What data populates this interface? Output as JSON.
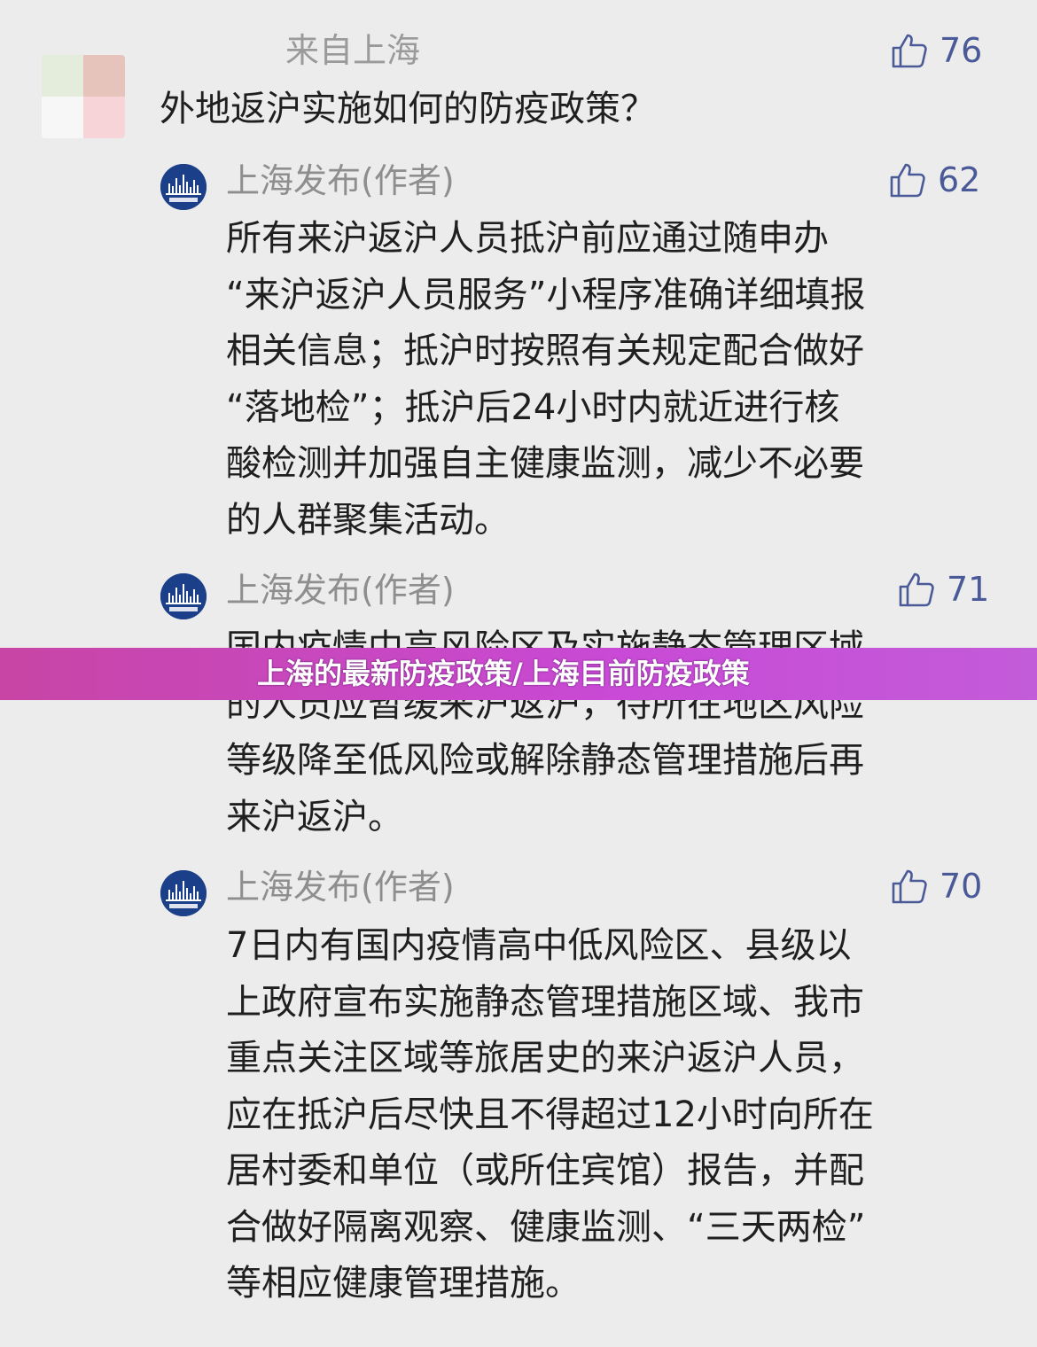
{
  "question": {
    "user_location": "来自上海",
    "text": "外地返沪实施如何的防疫政策？",
    "likes": "76"
  },
  "replies": [
    {
      "author": "上海发布(作者)",
      "avatar_caption": "上海发布",
      "likes": "62",
      "lines": [
        "所有来沪返沪人员抵沪前应通过随申办",
        "“来沪返沪人员服务”小程序准确详细填报",
        "相关信息；抵沪时按照有关规定配合做好",
        "“落地检”；抵沪后24小时内就近进行核",
        "酸检测并加强自主健康监测，减少不必要",
        "的人群聚集活动。"
      ]
    },
    {
      "author": "上海发布(作者)",
      "avatar_caption": "上海发布",
      "likes": "71",
      "lines": [
        "国内疫情中高风险区及实施静态管理区域",
        "的人员应暂缓来沪返沪，待所在地区风险",
        "等级降至低风险或解除静态管理措施后再",
        "来沪返沪。"
      ]
    },
    {
      "author": "上海发布(作者)",
      "avatar_caption": "上海发布",
      "likes": "70",
      "lines": [
        "7日内有国内疫情高中低风险区、县级以",
        "上政府宣布实施静态管理措施区域、我市",
        "重点关注区域等旅居史的来沪返沪人员，",
        "应在抵沪后尽快且不得超过12小时向所在",
        "居村委和单位（或所住宾馆）报告，并配",
        "合做好隔离观察、健康监测、“三天两检”",
        "等相应健康管理措施。"
      ]
    }
  ],
  "banner": {
    "text": "上海的最新防疫政策/上海目前防疫政策"
  },
  "icons": {
    "like": "thumbs-up-icon",
    "avatar": "shanghai-skyline-logo"
  },
  "colors": {
    "background": "#ececec",
    "like_color": "#4a5a98",
    "banner": "#c84ad6",
    "avatar_blue": "#1c3f8a"
  }
}
